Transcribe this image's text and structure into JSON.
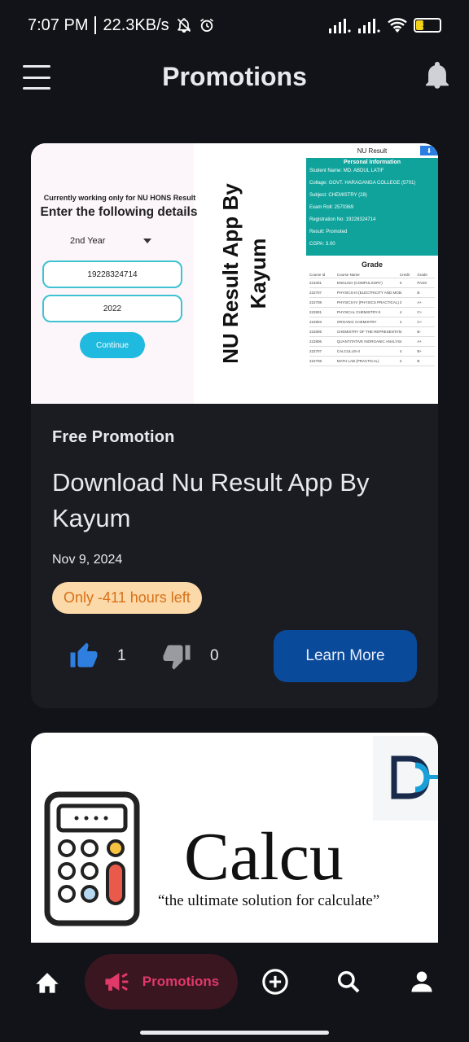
{
  "status_bar": {
    "time": "7:07 PM",
    "speed": "22.3KB/s",
    "battery": "31"
  },
  "app_bar": {
    "title": "Promotions"
  },
  "cards": [
    {
      "banner": {
        "working_note": "Currently working only for NU HONS Result",
        "heading": "Enter the following details",
        "year_select": "2nd Year",
        "registration_input": "19228324714",
        "year_input": "2022",
        "continue_label": "Continue",
        "vertical_title_1": "NU Result App By",
        "vertical_title_2": "Kayum",
        "result_header": "NU Result",
        "personal_info_title": "Personal Information",
        "info_rows": [
          "Student Name: MD. ABDUL LATIF",
          "Collage: GOVT. HARAGANGA COLLEGE (5701)",
          "Subject: CHEMISTRY (28)",
          "Exam Roll: 2570369",
          "Registration No: 19228324714",
          "Result: Promoted",
          "CGPA: 3.00"
        ],
        "grade_title": "Grade",
        "grade_headers": [
          "Course id",
          "Course Name",
          "Credit",
          "Grade"
        ],
        "grade_rows": [
          [
            "221001",
            "ENGLISH (COMPULSORY)",
            "0",
            "PASS"
          ],
          [
            "222707",
            "PHYSICS-III (ELECTRICITY AND MODERN PHYSICS)",
            "4",
            "B"
          ],
          [
            "222708",
            "PHYSICS-IV (PHYSICS PRACTICAL)",
            "2",
            "A+"
          ],
          [
            "222801",
            "PHYSICAL CHEMISTRY-II",
            "4",
            "C+"
          ],
          [
            "222803",
            "ORGANIC CHEMISTRY",
            "4",
            "C+"
          ],
          [
            "222805",
            "CHEMISTRY OF THE REPRESENTATIVE ELEMENTS",
            "4",
            "B-"
          ],
          [
            "222806",
            "QUANTITATIVE INORGANIC ANALYSIS (PRACTICAL)",
            "4",
            "A+"
          ],
          [
            "222707",
            "CALCULUS-II",
            "4",
            "B+"
          ],
          [
            "222708",
            "MATH LAB (PRACTICAL)",
            "2",
            "B"
          ]
        ]
      },
      "type": "Free Promotion",
      "title": "Download Nu Result App By Kayum",
      "date": "Nov 9, 2024",
      "time_left": "Only -411 hours left",
      "likes": "1",
      "dislikes": "0",
      "cta": "Learn More"
    },
    {
      "banner": {
        "brand_word": "Calcu",
        "tagline": "“the ultimate solution for calculate”"
      }
    }
  ],
  "bottom_nav": {
    "promotions_label": "Promotions"
  },
  "colors": {
    "background": "#111318",
    "card": "#1b1c21",
    "accent_blue": "#0a4a9a",
    "accent_pink": "#e0396a",
    "badge_bg": "#fcd9a8",
    "badge_text": "#d7711a",
    "like_blue": "#2f7fe0"
  },
  "icons": {
    "menu": "hamburger-menu-icon",
    "bell": "notification-bell-icon",
    "like": "thumbs-up-icon",
    "dislike": "thumbs-down-icon",
    "home": "home-icon",
    "promotions": "megaphone-icon",
    "add": "add-circle-icon",
    "search": "search-icon",
    "profile": "person-icon"
  }
}
